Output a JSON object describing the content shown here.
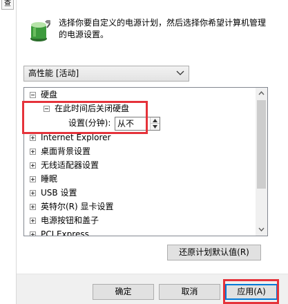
{
  "left_tab": {
    "label": "查"
  },
  "header": {
    "icon": "power-plan-battery-icon",
    "instruction_line1": "选择你要自定义的电源计划，然后选择你希望计算机管理",
    "instruction_line2": "的电源设置。"
  },
  "plan_select": {
    "selected": "高性能 [活动]"
  },
  "tree": {
    "items": [
      {
        "label": "硬盘",
        "expanded": true
      },
      {
        "label": "在此时间后关闭硬盘",
        "expanded": true
      },
      {
        "label": "Internet Explorer",
        "expanded": false
      },
      {
        "label": "桌面背景设置",
        "expanded": false
      },
      {
        "label": "无线适配器设置",
        "expanded": false
      },
      {
        "label": "睡眠",
        "expanded": false
      },
      {
        "label": "USB 设置",
        "expanded": false
      },
      {
        "label": "英特尔(R) 显卡设置",
        "expanded": false
      },
      {
        "label": "电源按钮和盖子",
        "expanded": false
      },
      {
        "label": "PCI Express",
        "expanded": false
      }
    ],
    "setting": {
      "label": "设置(分钟):",
      "value": "从不"
    }
  },
  "buttons": {
    "restore": "还原计划默认值(R)",
    "ok": "确定",
    "cancel": "取消",
    "apply": "应用(A)"
  },
  "colors": {
    "highlight": "#e5323a",
    "focus_border": "#0078d7"
  }
}
